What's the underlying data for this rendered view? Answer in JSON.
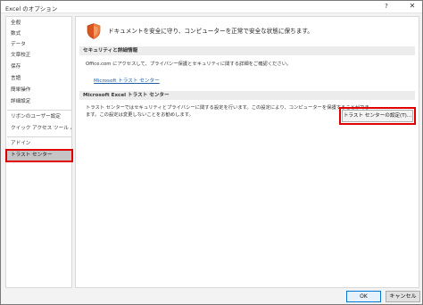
{
  "window": {
    "title": "Excel のオプション",
    "help_label": "?",
    "close_label": "✕"
  },
  "sidebar": {
    "items": [
      {
        "label": "全般"
      },
      {
        "label": "数式"
      },
      {
        "label": "データ"
      },
      {
        "label": "文章校正"
      },
      {
        "label": "保存"
      },
      {
        "label": "言語"
      },
      {
        "label": "簡単操作"
      },
      {
        "label": "詳細設定"
      },
      {
        "label": "リボンのユーザー設定"
      },
      {
        "label": "クイック アクセス ツール バー"
      },
      {
        "label": "アドイン"
      },
      {
        "label": "トラスト センター",
        "selected": true
      }
    ]
  },
  "main": {
    "header": "ドキュメントを安全に守り、コンピューターを正常で安全な状態に保ちます。",
    "security_section": {
      "title": "セキュリティと詳細情報",
      "text": "Office.com にアクセスして、プライバシー保護とセキュリティに関する詳細をご確認ください。",
      "link": "Microsoft トラスト センター"
    },
    "trust_section": {
      "title": "Microsoft Excel トラスト センター",
      "text_line1": "トラスト センターではセキュリティとプライバシーに関する設定を行います。この設定により、コンピューターを保護することができ",
      "text_line2": "ます。この設定は変更しないことをお勧めします。",
      "button": "トラスト センターの設定(T)..."
    }
  },
  "footer": {
    "ok": "OK",
    "cancel": "キャンセル"
  },
  "colors": {
    "highlight": "#e00000",
    "link": "#1f5ea8",
    "shield": "#d9541e"
  }
}
